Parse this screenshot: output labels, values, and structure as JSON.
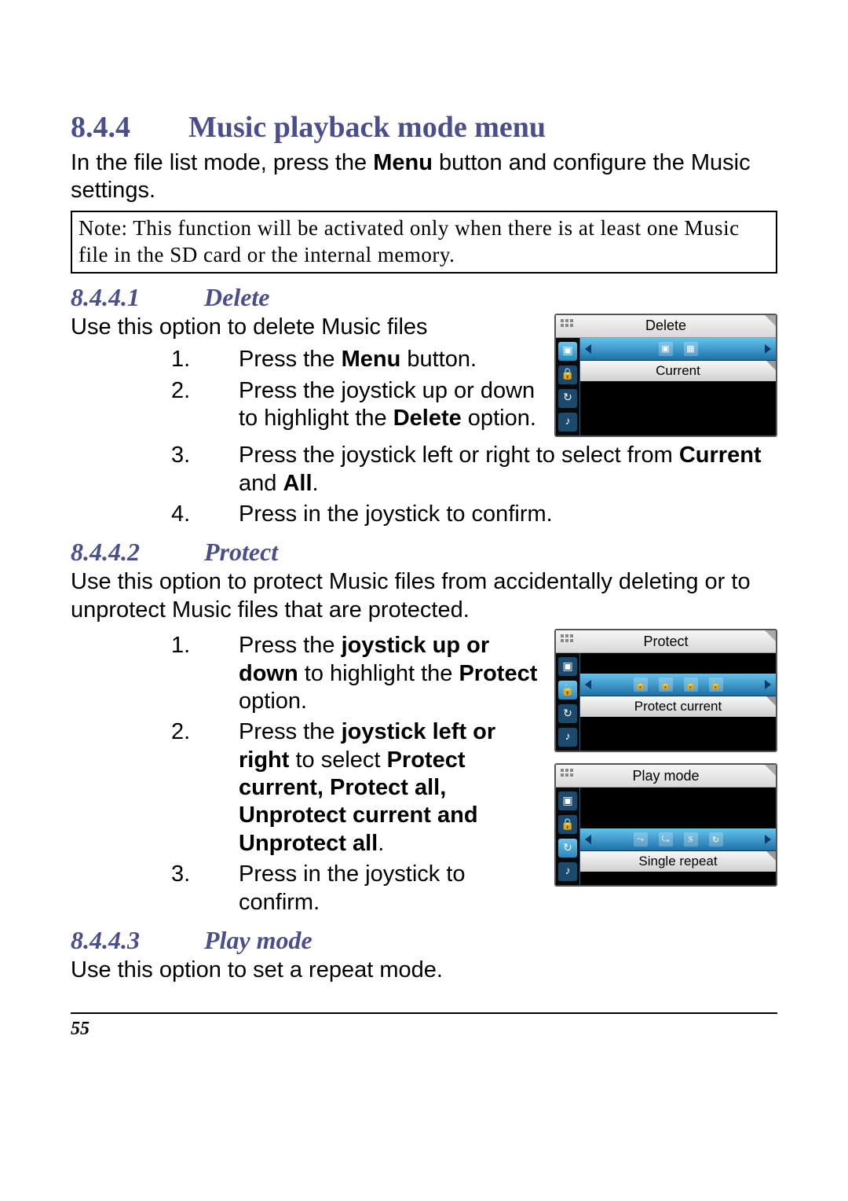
{
  "h2_num": "8.4.4",
  "h2_title": "Music playback mode menu",
  "intro_pre": "In the file list mode, press the ",
  "intro_bold": "Menu",
  "intro_post": " button and configure the Music settings.",
  "note": "Note: This function will be activated only when there is at least one Music file in the SD card or the internal memory.",
  "s1": {
    "num": "8.4.4.1",
    "title": "Delete",
    "intro": "Use this option to delete Music files",
    "steps": [
      {
        "n": "1.",
        "pre": "Press the ",
        "b": "Menu",
        "post": " button."
      },
      {
        "n": "2.",
        "pre": "Press the joystick up or down to highlight the ",
        "b": "Delete",
        "post": " option."
      },
      {
        "n": "3.",
        "pre": "Press the joystick left or right to select from ",
        "b": "Current",
        "mid": " and ",
        "b2": "All",
        "post": "."
      },
      {
        "n": "4.",
        "pre": "Press in the joystick to confirm."
      }
    ],
    "shot": {
      "title": "Delete",
      "value": "Current"
    }
  },
  "s2": {
    "num": "8.4.4.2",
    "title": "Protect",
    "intro": "Use this option to protect Music files from accidentally deleting or to unprotect Music files that are protected.",
    "steps": [
      {
        "n": "1.",
        "pre": "Press the ",
        "b": "joystick up or down",
        "post": " to highlight the ",
        "b2": "Protect",
        "post2": " option."
      },
      {
        "n": "2.",
        "pre": "Press the ",
        "b": "joystick left or right",
        "post": " to select ",
        "b2": "Protect current, Protect all, Unprotect current and Unprotect all",
        "post2": "."
      },
      {
        "n": "3.",
        "pre": "Press in the joystick to confirm."
      }
    ],
    "shot": {
      "title": "Protect",
      "value": "Protect current"
    }
  },
  "s3": {
    "num": "8.4.4.3",
    "title": "Play mode",
    "intro": "Use this option to set a repeat mode.",
    "shot": {
      "title": "Play mode",
      "value": "Single repeat"
    }
  },
  "page_number": "55"
}
